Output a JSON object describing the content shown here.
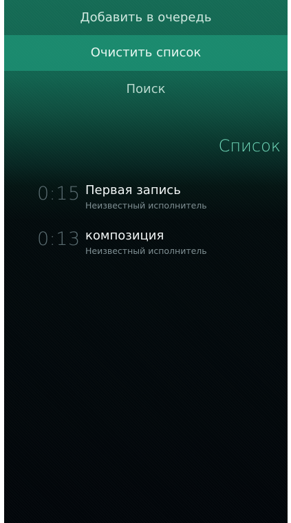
{
  "pulley_menu": {
    "items": [
      {
        "label": "Добавить в очередь"
      },
      {
        "label": "Очистить список"
      },
      {
        "label": "Поиск"
      }
    ]
  },
  "page": {
    "header": "Список"
  },
  "tracks": [
    {
      "duration": "0:15",
      "title": "Первая запись",
      "artist": "Неизвестный исполнитель"
    },
    {
      "duration": "0:13",
      "title": "композиция",
      "artist": "Неизвестный исполнитель"
    }
  ],
  "colors": {
    "highlight": "#20a080",
    "header_text": "#6fd7b8",
    "background_bottom": "#02060a"
  }
}
